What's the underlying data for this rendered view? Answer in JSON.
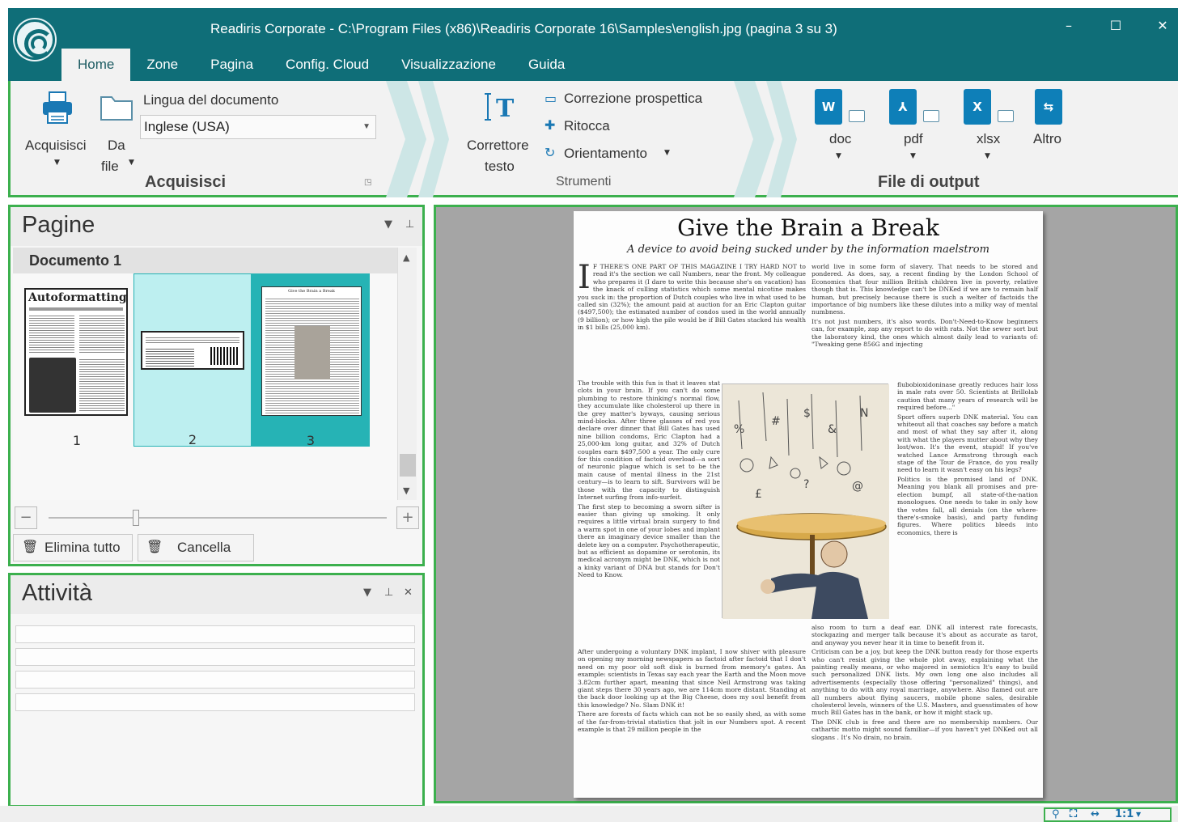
{
  "window": {
    "title": "Readiris Corporate - C:\\Program Files (x86)\\Readiris Corporate 16\\Samples\\english.jpg (pagina 3 su 3)",
    "minimize": "–",
    "maximize": "☐",
    "close": "✕"
  },
  "tabs": [
    {
      "label": "Home"
    },
    {
      "label": "Zone"
    },
    {
      "label": "Pagina"
    },
    {
      "label": "Config. Cloud"
    },
    {
      "label": "Visualizzazione"
    },
    {
      "label": "Guida"
    }
  ],
  "ribbon": {
    "acquire": {
      "scan_label": "Acquisisci",
      "from_file_line1": "Da",
      "from_file_line2": "file",
      "language_label": "Lingua del documento",
      "language_value": "Inglese (USA)",
      "group_title": "Acquisisci"
    },
    "tools": {
      "text_corrector_line1": "Correttore",
      "text_corrector_line2": "testo",
      "perspective": "Correzione prospettica",
      "retouch": "Ritocca",
      "orientation": "Orientamento",
      "group_title": "Strumenti"
    },
    "output": {
      "doc": "doc",
      "pdf": "pdf",
      "xlsx": "xlsx",
      "other": "Altro",
      "group_title": "File di output"
    }
  },
  "pages_panel": {
    "title": "Pagine",
    "document_label": "Documento 1",
    "thumbnails": [
      {
        "number": "1",
        "heading": "Autoformatting",
        "selected": false
      },
      {
        "number": "2",
        "heading": "",
        "selected": true
      },
      {
        "number": "3",
        "heading": "Give the Brain a Break",
        "selected": true,
        "current": true
      }
    ],
    "delete_all": "Elimina tutto",
    "delete": "Cancella"
  },
  "activity_panel": {
    "title": "Attività",
    "rows": 4
  },
  "document": {
    "title": "Give the Brain a Break",
    "subtitle": "A device to avoid being sucked under by the information maelstrom",
    "col1_p1": "F THERE'S ONE PART OF THIS MAGAZINE I TRY HARD NOT to read it's the section we call Numbers, near the front. My colleague who prepares it (I dare to write this because she's on vacation) has the knack of culling statistics which some mental nicotine makes you suck in: the proportion of Dutch couples who live in what used to be called sin (32%); the amount paid at auction for an Eric Clapton guitar ($497,500); the estimated number of condos used in the world annually (9 billion); or how high the pile would be if Bill Gates stacked his wealth in $1 bills (25,000 km).",
    "col1_p2": "The trouble with this fun is that it leaves stat clots in your brain. If you can't do some plumbing to restore thinking's normal flow, they accumulate like cholesterol up there in the grey matter's byways, causing serious mind-blocks. After three glasses of red you declare over dinner that Bill Gates has used nine billion condoms, Eric Clapton had a 25,000-km long guitar, and 32% of Dutch couples earn $497,500 a year. The only cure for this condition of factoid overload—a sort of neuronic plague which is set to be the main cause of mental illness in the 21st century—is to learn to sift. Survivors will be those with the capacity to distinguish Internet surfing from info-surfeit.",
    "col1_p3": "The first step to becoming a sworn sifter is easier than giving up smoking. It only requires a little virtual brain surgery to find a warm spot in one of your lobes and implant there an imaginary device smaller than the delete key on a computer. Psychotherapeutic, but as efficient as dopamine or serotonin, its medical acronym might be DNK, which is not a kinky variant of DNA but stands for Don't Need to Know.",
    "col1_p4": "After undergoing a voluntary DNK implant, I now shiver with pleasure on opening my morning newspapers as factoid after factoid that I don't need on my poor old soft disk is burned from memory's gates. An example: scientists in Texas say each year the Earth and the Moon move 3.82cm further apart, meaning that since Neil Armstrong was taking giant steps there 30 years ago, we are 114cm more distant. Standing at the back door looking up at the Big Cheese, does my soul benefit from this knowledge? No. Slam DNK it!",
    "col1_p5": "There are forests of facts which can not be so easily shed, as with some of the far-from-trivial statistics that jolt in our Numbers spot. A recent example is that 29 million people in the",
    "col2_p1": "world live in some form of slavery. That needs to be stored and pondered. As does, say, a recent finding by the London School of Economics that four million British children live in poverty, relative though that is. This knowledge can't be DNKed if we are to remain half human, but precisely because there is such a welter of factoids the importance of big numbers like these dilutes into a milky way of mental numbness.",
    "col2_p2": "It's not just numbers, it's also words. Don't-Need-to-Know beginners can, for example, zap any report to do with rats. Not the sewer sort but the laboratory kind, the ones which almost daily lead to variants of: \"Tweaking gene 856G and injecting",
    "col3_p1": "flubobioxidoninase greatly reduces hair loss in male rats over 50. Scientists at Brillolab caution that many years of research will be required before...\"",
    "col3_p2": "Sport offers superb DNK material. You can whiteout all that coaches say before a match and most of what they say after it, along with what the players mutter about why they lost/won. It's the event, stupid! If you've watched Lance Armstrong through each stage of the Tour de France, do you really need to learn it wasn't easy on his legs?",
    "col3_p3": "Politics is the promised land of DNK. Meaning you blank all promises and pre-election bumpf, all state-of-the-nation monologues. One needs to take in only how the votes fall, all denials (on the where-there's-smoke basis), and party funding figures. Where politics bleeds into economics, there is",
    "col4_p1": "also room to turn a deaf ear. DNK all interest rate forecasts, stockgazing and merger talk because it's about as accurate as tarot, and anyway you never hear it in time to benefit from it.",
    "col4_p2": "Criticism can be a joy, but keep the DNK button ready for those experts who can't resist giving the whole plot away, explaining what the painting really means, or who majored in semiotics It's easy to build such personalized DNK lists. My own long one also includes all advertisements (especially those offering \"personalized\" things), and anything to do with any royal marriage, anywhere. Also flamed out are all numbers about flying saucers, mobile phone sales, desirable cholesterol levels, winners of the U.S. Masters, and guesstimates of how much Bill Gates has in the bank, or how it might stack up.",
    "col4_p3": "The DNK club is free and there are no membership numbers. Our cathartic motto might sound familiar—if you haven't yet DNKed out all slogans . It's No drain, no brain."
  },
  "statusbar": {
    "zoom_label": "1:1"
  },
  "colors": {
    "titlebar": "#0f6e78",
    "accent_green": "#3cb04e",
    "ribbon_bg": "#f2f2f2",
    "thumb_selected": "#bdeff0",
    "thumb_current": "#26b3b5"
  }
}
